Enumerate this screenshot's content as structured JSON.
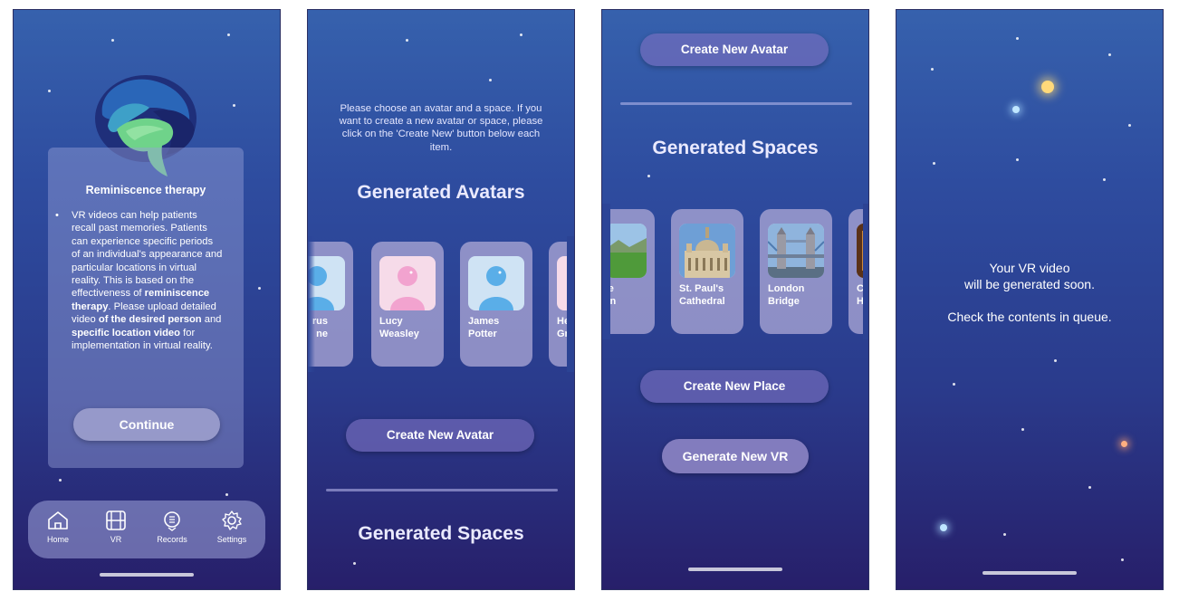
{
  "screen1": {
    "card_title": "Reminiscence therapy",
    "body_1": "VR videos can help patients recall past memories. Patients can experience specific periods of an individual's appearance and particular locations in virtual reality. This is based on the effectiveness of ",
    "body_bold_1": "reminiscence therapy",
    "body_2": ". Please upload detailed video ",
    "body_bold_2": "of the desired person",
    "body_3": " and ",
    "body_bold_3": "specific location video",
    "body_4": " for implementation in virtual reality.",
    "continue_label": "Continue",
    "tabs": [
      {
        "label": "Home",
        "icon": "home-icon"
      },
      {
        "label": "VR",
        "icon": "film-icon"
      },
      {
        "label": "Records",
        "icon": "microphone-icon"
      },
      {
        "label": "Settings",
        "icon": "gear-icon"
      }
    ]
  },
  "screen2": {
    "intro": "Please choose an avatar and a space. If you want to create a new avatar or space, please click on the 'Create New' button below each item.",
    "avatars_heading": "Generated Avatars",
    "avatars": [
      {
        "name": "rus\nne",
        "color": "#5aaee8"
      },
      {
        "name": "Lucy\nWeasley",
        "color": "#f2a3cf"
      },
      {
        "name": "James\nPotter",
        "color": "#5aaee8"
      },
      {
        "name": "He\nGr",
        "color": "#f2a3cf"
      }
    ],
    "create_avatar_label": "Create New Avatar",
    "spaces_heading": "Generated Spaces"
  },
  "screen3": {
    "create_avatar_label": "Create New Avatar",
    "spaces_heading": "Generated Spaces",
    "places": [
      {
        "name": "ne\nwn"
      },
      {
        "name": "St. Paul's\nCathedral"
      },
      {
        "name": "London\nBridge"
      },
      {
        "name": "C\nH"
      }
    ],
    "create_place_label": "Create New Place",
    "generate_vr_label": "Generate New VR"
  },
  "screen4": {
    "line1": "Your VR video",
    "line2": "will be generated soon.",
    "line3": "Check the contents in queue."
  },
  "colors": {
    "bg_top": "#3661ad",
    "bg_bottom": "#271f6a",
    "button": "#786ebe",
    "avatar_blue": "#5aaee8",
    "avatar_pink": "#f2a3cf"
  }
}
